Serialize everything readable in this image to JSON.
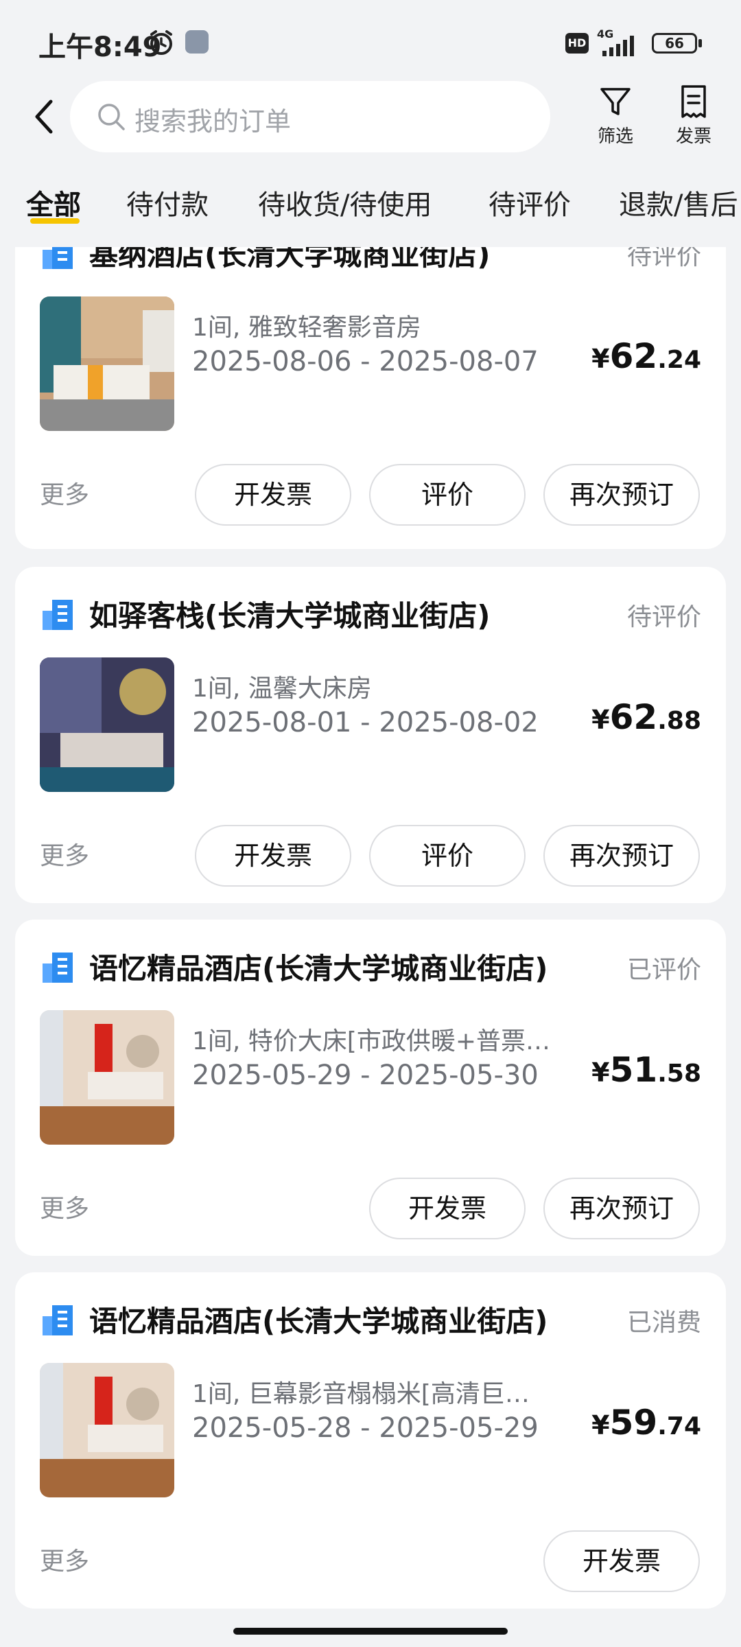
{
  "status_bar": {
    "time": "上午8:49",
    "hd": "HD",
    "network": "4G",
    "battery": "66"
  },
  "header": {
    "search_placeholder": "搜索我的订单",
    "filter_label": "筛选",
    "invoice_label": "发票"
  },
  "tabs": [
    {
      "label": "全部",
      "active": true
    },
    {
      "label": "待付款"
    },
    {
      "label": "待收货/待使用"
    },
    {
      "label": "待评价"
    },
    {
      "label": "退款/售后"
    }
  ],
  "orders": [
    {
      "hotel": "基纳酒店(长清大学城商业街店)",
      "status": "待评价",
      "room": "1间, 雅致轻奢影音房",
      "dates": "2025-08-06 - 2025-08-07",
      "price_symbol": "¥",
      "price_int": "62",
      "price_dec": ".24",
      "more": "更多",
      "buttons": [
        "开发票",
        "评价",
        "再次预订"
      ]
    },
    {
      "hotel": "如驿客栈(长清大学城商业街店)",
      "status": "待评价",
      "room": "1间, 温馨大床房",
      "dates": "2025-08-01 - 2025-08-02",
      "price_symbol": "¥",
      "price_int": "62",
      "price_dec": ".88",
      "more": "更多",
      "buttons": [
        "开发票",
        "评价",
        "再次预订"
      ]
    },
    {
      "hotel": "语忆精品酒店(长清大学城商业街店)",
      "status": "已评价",
      "room": "1间, 特价大床[市政供暖+普票…",
      "dates": "2025-05-29 - 2025-05-30",
      "price_symbol": "¥",
      "price_int": "51",
      "price_dec": ".58",
      "more": "更多",
      "buttons": [
        "开发票",
        "再次预订"
      ]
    },
    {
      "hotel": "语忆精品酒店(长清大学城商业街店)",
      "status": "已消费",
      "room": "1间, 巨幕影音榻榻米[高清巨…",
      "dates": "2025-05-28 - 2025-05-29",
      "price_symbol": "¥",
      "price_int": "59",
      "price_dec": ".74",
      "more": "更多",
      "buttons": [
        "开发票"
      ]
    }
  ],
  "colors": {
    "accent": "#f6c400",
    "hotel_icon": "#2d8cf0"
  }
}
